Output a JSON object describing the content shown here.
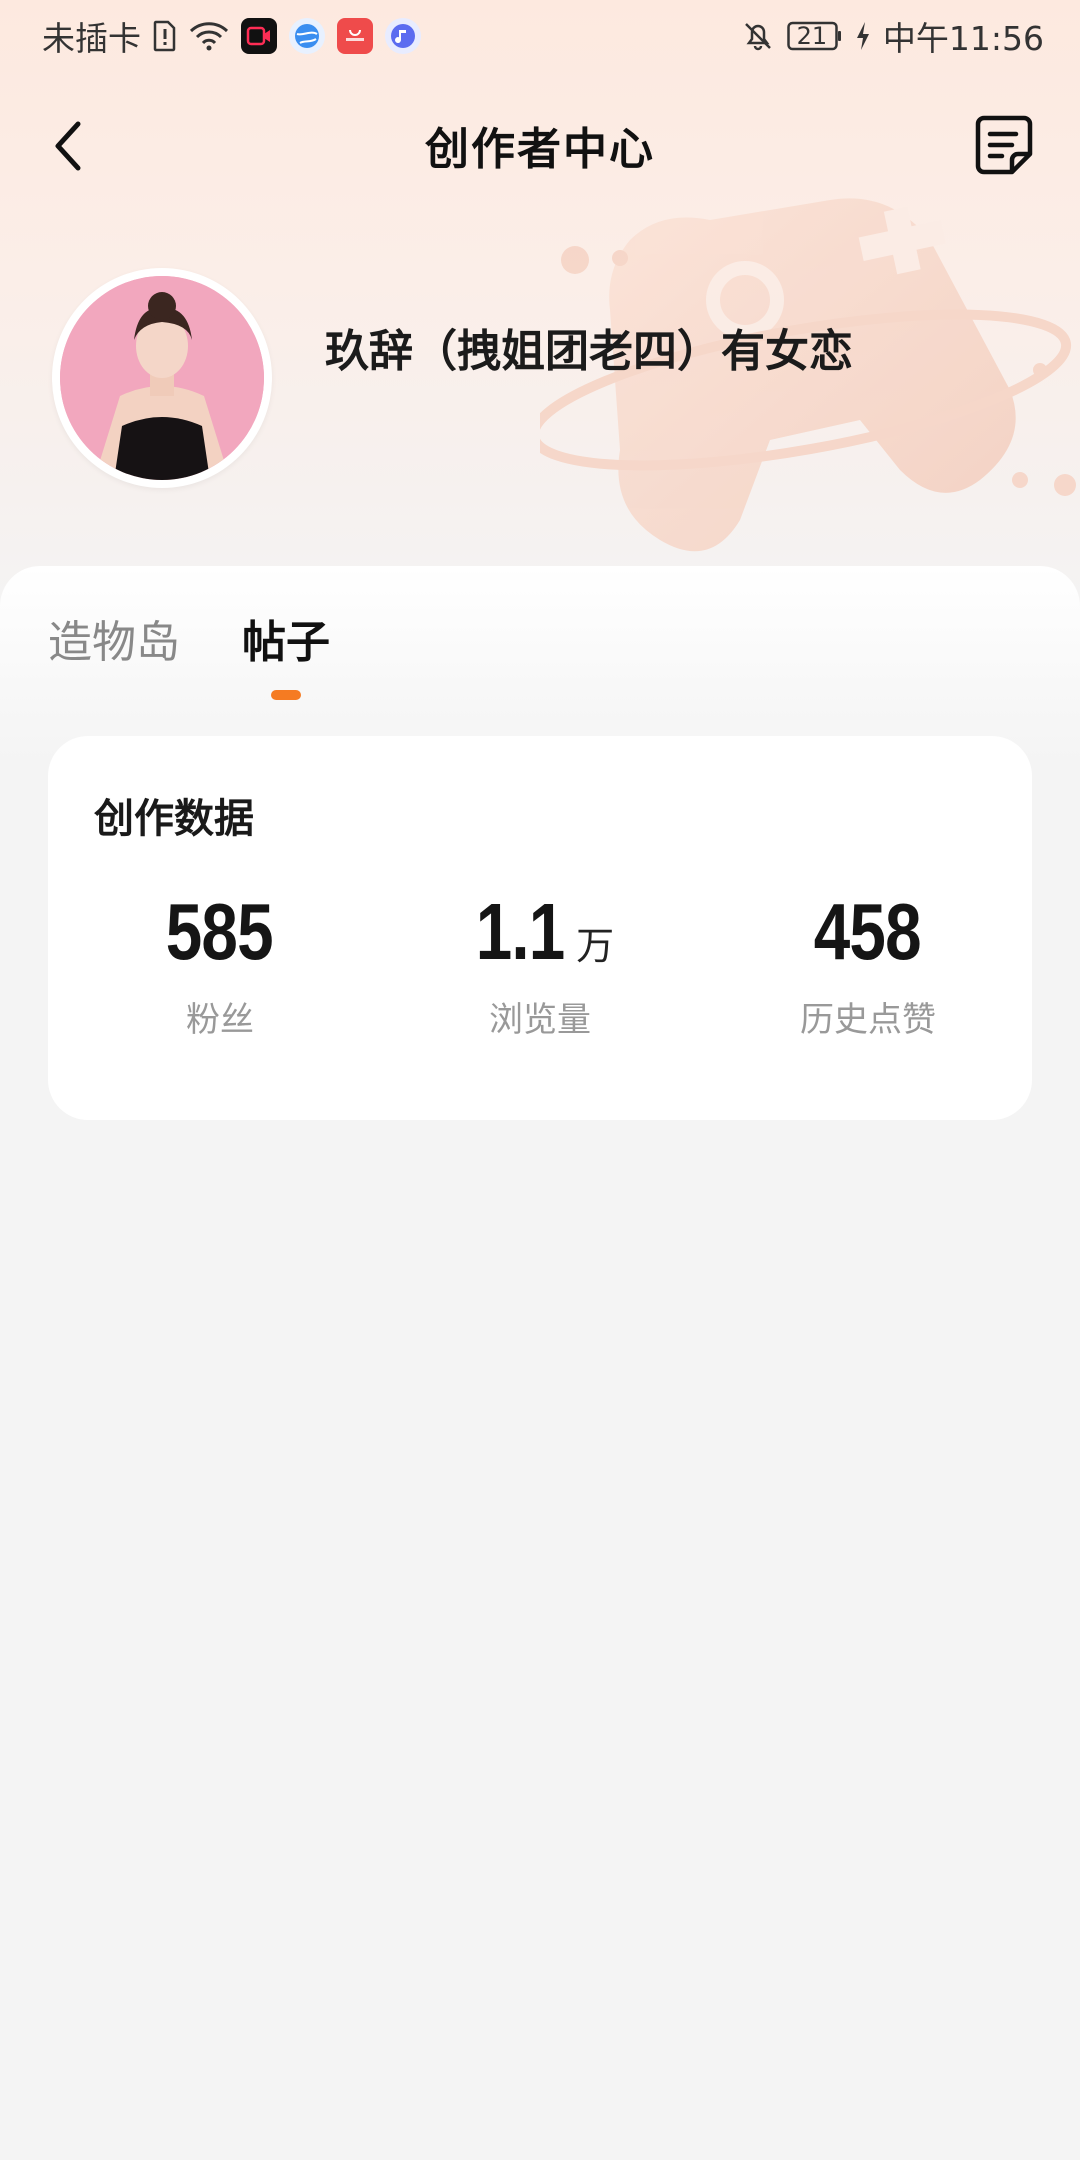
{
  "status_bar": {
    "carrier": "未插卡",
    "battery": "21",
    "time": "中午11:56",
    "icons": [
      "sim-icon",
      "wifi-icon",
      "video-app-icon",
      "browser-app-icon",
      "huawei-appgallery-icon",
      "music-app-icon",
      "bell-off-icon",
      "battery-icon",
      "charging-icon"
    ]
  },
  "header": {
    "title": "创作者中心",
    "back_icon": "chevron-left-icon",
    "action_icon": "note-icon"
  },
  "profile": {
    "username": "玖辞（拽姐团老四）有女恋"
  },
  "tabs": [
    {
      "label": "造物岛",
      "active": false
    },
    {
      "label": "帖子",
      "active": true
    }
  ],
  "stats_card": {
    "title": "创作数据",
    "stats": [
      {
        "value": "585",
        "unit": "",
        "label": "粉丝"
      },
      {
        "value": "1.1",
        "unit": "万",
        "label": "浏览量"
      },
      {
        "value": "458",
        "unit": "",
        "label": "历史点赞"
      }
    ]
  },
  "colors": {
    "accent": "#f57b22",
    "header_gradient_top": "#fde9df",
    "background": "#f4f4f4"
  }
}
